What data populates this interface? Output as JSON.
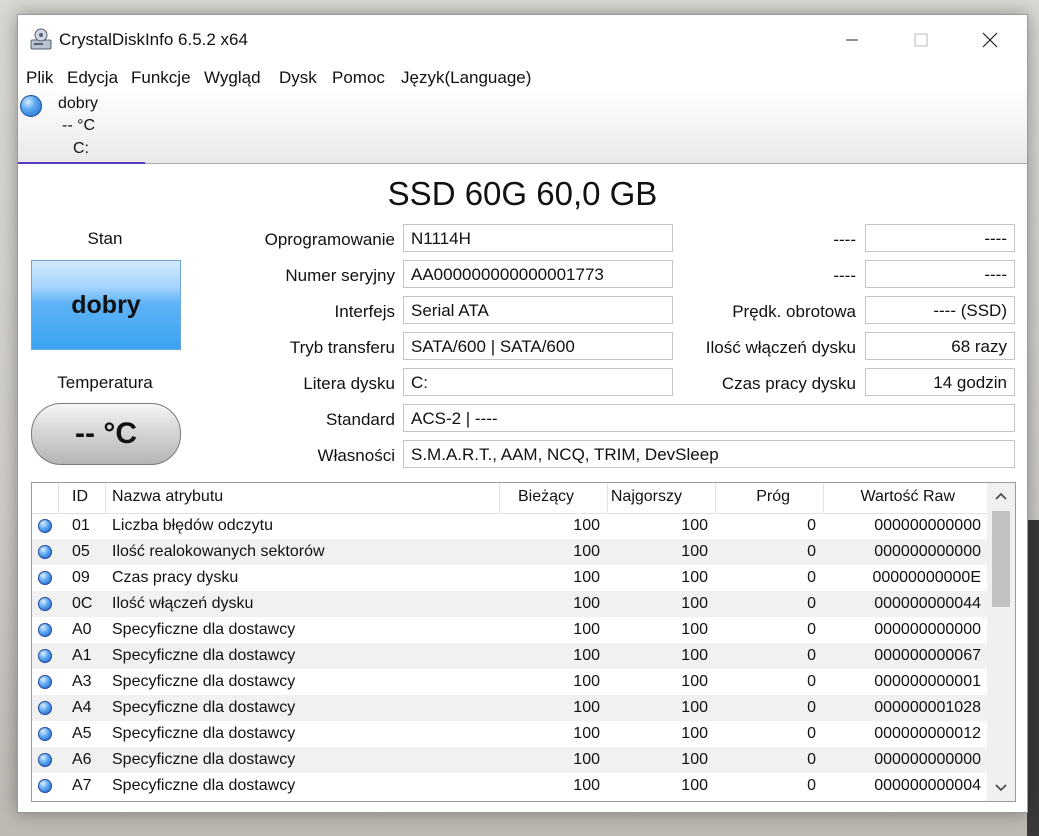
{
  "window": {
    "title": "CrystalDiskInfo 6.5.2 x64",
    "controls": {
      "minimize": "minimize-icon",
      "maximize": "maximize-icon",
      "close": "close-icon"
    }
  },
  "menu": [
    "Plik",
    "Edycja",
    "Funkcje",
    "Wygląd",
    "Dysk",
    "Pomoc",
    "Język(Language)"
  ],
  "disk_tab": {
    "status": "dobry",
    "temperature": "-- °C",
    "letter": "C:"
  },
  "model_title": "SSD 60G 60,0 GB",
  "health": {
    "label": "Stan",
    "value": "dobry",
    "color": "#3aa3f2"
  },
  "temperature": {
    "label": "Temperatura",
    "value": "-- °C"
  },
  "fields": [
    {
      "label": "Oprogramowanie",
      "value": "N1114H"
    },
    {
      "label": "Numer seryjny",
      "value": "AA000000000000001773"
    },
    {
      "label": "Interfejs",
      "value": "Serial ATA"
    },
    {
      "label": "Tryb transferu",
      "value": "SATA/600 | SATA/600"
    },
    {
      "label": "Litera dysku",
      "value": "C:"
    },
    {
      "label": "Standard",
      "value": "ACS-2 | ----"
    },
    {
      "label": "Własności",
      "value": "S.M.A.R.T., AAM, NCQ, TRIM, DevSleep"
    }
  ],
  "right_fields": [
    {
      "label": "----",
      "value": "----"
    },
    {
      "label": "----",
      "value": "----"
    },
    {
      "label": "Prędk. obrotowa",
      "value": "---- (SSD)"
    },
    {
      "label": "Ilość włączeń dysku",
      "value": "68 razy"
    },
    {
      "label": "Czas pracy dysku",
      "value": "14 godzin"
    }
  ],
  "smart": {
    "headers": {
      "id": "ID",
      "name": "Nazwa atrybutu",
      "current": "Bieżący",
      "worst": "Najgorszy",
      "threshold": "Próg",
      "raw": "Wartość Raw"
    },
    "rows": [
      {
        "id": "01",
        "name": "Liczba błędów odczytu",
        "current": "100",
        "worst": "100",
        "threshold": "0",
        "raw": "000000000000"
      },
      {
        "id": "05",
        "name": "Ilość realokowanych sektorów",
        "current": "100",
        "worst": "100",
        "threshold": "0",
        "raw": "000000000000"
      },
      {
        "id": "09",
        "name": "Czas pracy dysku",
        "current": "100",
        "worst": "100",
        "threshold": "0",
        "raw": "00000000000E"
      },
      {
        "id": "0C",
        "name": "Ilość włączeń dysku",
        "current": "100",
        "worst": "100",
        "threshold": "0",
        "raw": "000000000044"
      },
      {
        "id": "A0",
        "name": "Specyficzne dla dostawcy",
        "current": "100",
        "worst": "100",
        "threshold": "0",
        "raw": "000000000000"
      },
      {
        "id": "A1",
        "name": "Specyficzne dla dostawcy",
        "current": "100",
        "worst": "100",
        "threshold": "0",
        "raw": "000000000067"
      },
      {
        "id": "A3",
        "name": "Specyficzne dla dostawcy",
        "current": "100",
        "worst": "100",
        "threshold": "0",
        "raw": "000000000001"
      },
      {
        "id": "A4",
        "name": "Specyficzne dla dostawcy",
        "current": "100",
        "worst": "100",
        "threshold": "0",
        "raw": "000000001028"
      },
      {
        "id": "A5",
        "name": "Specyficzne dla dostawcy",
        "current": "100",
        "worst": "100",
        "threshold": "0",
        "raw": "000000000012"
      },
      {
        "id": "A6",
        "name": "Specyficzne dla dostawcy",
        "current": "100",
        "worst": "100",
        "threshold": "0",
        "raw": "000000000000"
      },
      {
        "id": "A7",
        "name": "Specyficzne dla dostawcy",
        "current": "100",
        "worst": "100",
        "threshold": "0",
        "raw": "000000000004"
      }
    ]
  }
}
